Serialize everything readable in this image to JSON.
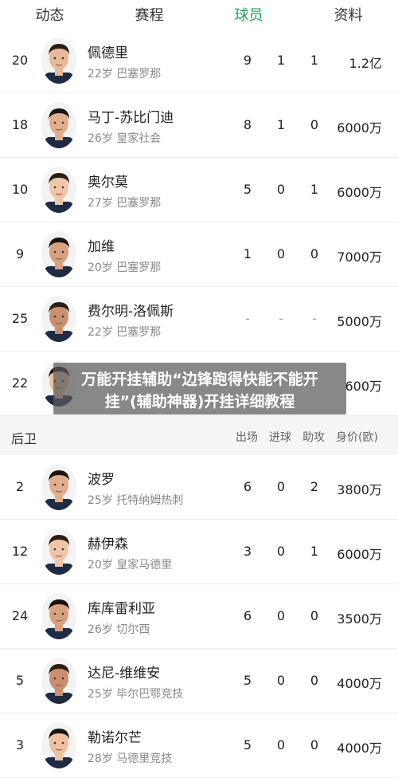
{
  "tabs": [
    {
      "label": "动态",
      "active": false
    },
    {
      "label": "赛程",
      "active": false
    },
    {
      "label": "球员",
      "active": true
    },
    {
      "label": "资料",
      "active": false
    }
  ],
  "accent_color": "#1aa35a",
  "forwards": [
    {
      "number": "20",
      "name": "佩德里",
      "meta": "22岁 巴塞罗那",
      "apps": "9",
      "goals": "1",
      "assists": "1",
      "value": "1.2亿"
    },
    {
      "number": "18",
      "name": "马丁-苏比门迪",
      "meta": "26岁 皇家社会",
      "apps": "8",
      "goals": "1",
      "assists": "0",
      "value": "6000万"
    },
    {
      "number": "10",
      "name": "奥尔莫",
      "meta": "27岁 巴塞罗那",
      "apps": "5",
      "goals": "0",
      "assists": "1",
      "value": "6000万"
    },
    {
      "number": "9",
      "name": "加维",
      "meta": "20岁 巴塞罗那",
      "apps": "1",
      "goals": "0",
      "assists": "0",
      "value": "7000万"
    },
    {
      "number": "25",
      "name": "费尔明-洛佩斯",
      "meta": "22岁 巴塞罗那",
      "apps": "-",
      "goals": "-",
      "assists": "-",
      "value": "5000万"
    },
    {
      "number": "22",
      "name": "",
      "meta": "",
      "apps": "",
      "goals": "",
      "assists": "",
      "value": "600万"
    }
  ],
  "defenders_header": {
    "title": "后卫",
    "apps": "出场",
    "goals": "进球",
    "assists": "助攻",
    "value": "身价(欧)"
  },
  "defenders": [
    {
      "number": "2",
      "name": "波罗",
      "meta": "25岁 托特纳姆热刺",
      "apps": "6",
      "goals": "0",
      "assists": "2",
      "value": "3800万"
    },
    {
      "number": "12",
      "name": "赫伊森",
      "meta": "20岁 皇家马德里",
      "apps": "3",
      "goals": "0",
      "assists": "1",
      "value": "6000万"
    },
    {
      "number": "24",
      "name": "库库雷利亚",
      "meta": "26岁 切尔西",
      "apps": "6",
      "goals": "0",
      "assists": "0",
      "value": "3500万"
    },
    {
      "number": "5",
      "name": "达尼-维维安",
      "meta": "25岁 毕尔巴鄂竞技",
      "apps": "5",
      "goals": "0",
      "assists": "0",
      "value": "4000万"
    },
    {
      "number": "3",
      "name": "勒诺尔芒",
      "meta": "28岁 马德里竞技",
      "apps": "5",
      "goals": "0",
      "assists": "0",
      "value": "4000万"
    }
  ],
  "overlay": {
    "line1": "万能开挂辅助“边锋跑得快能不能开",
    "line2": "挂”(辅助神器)开挂详细教程"
  }
}
